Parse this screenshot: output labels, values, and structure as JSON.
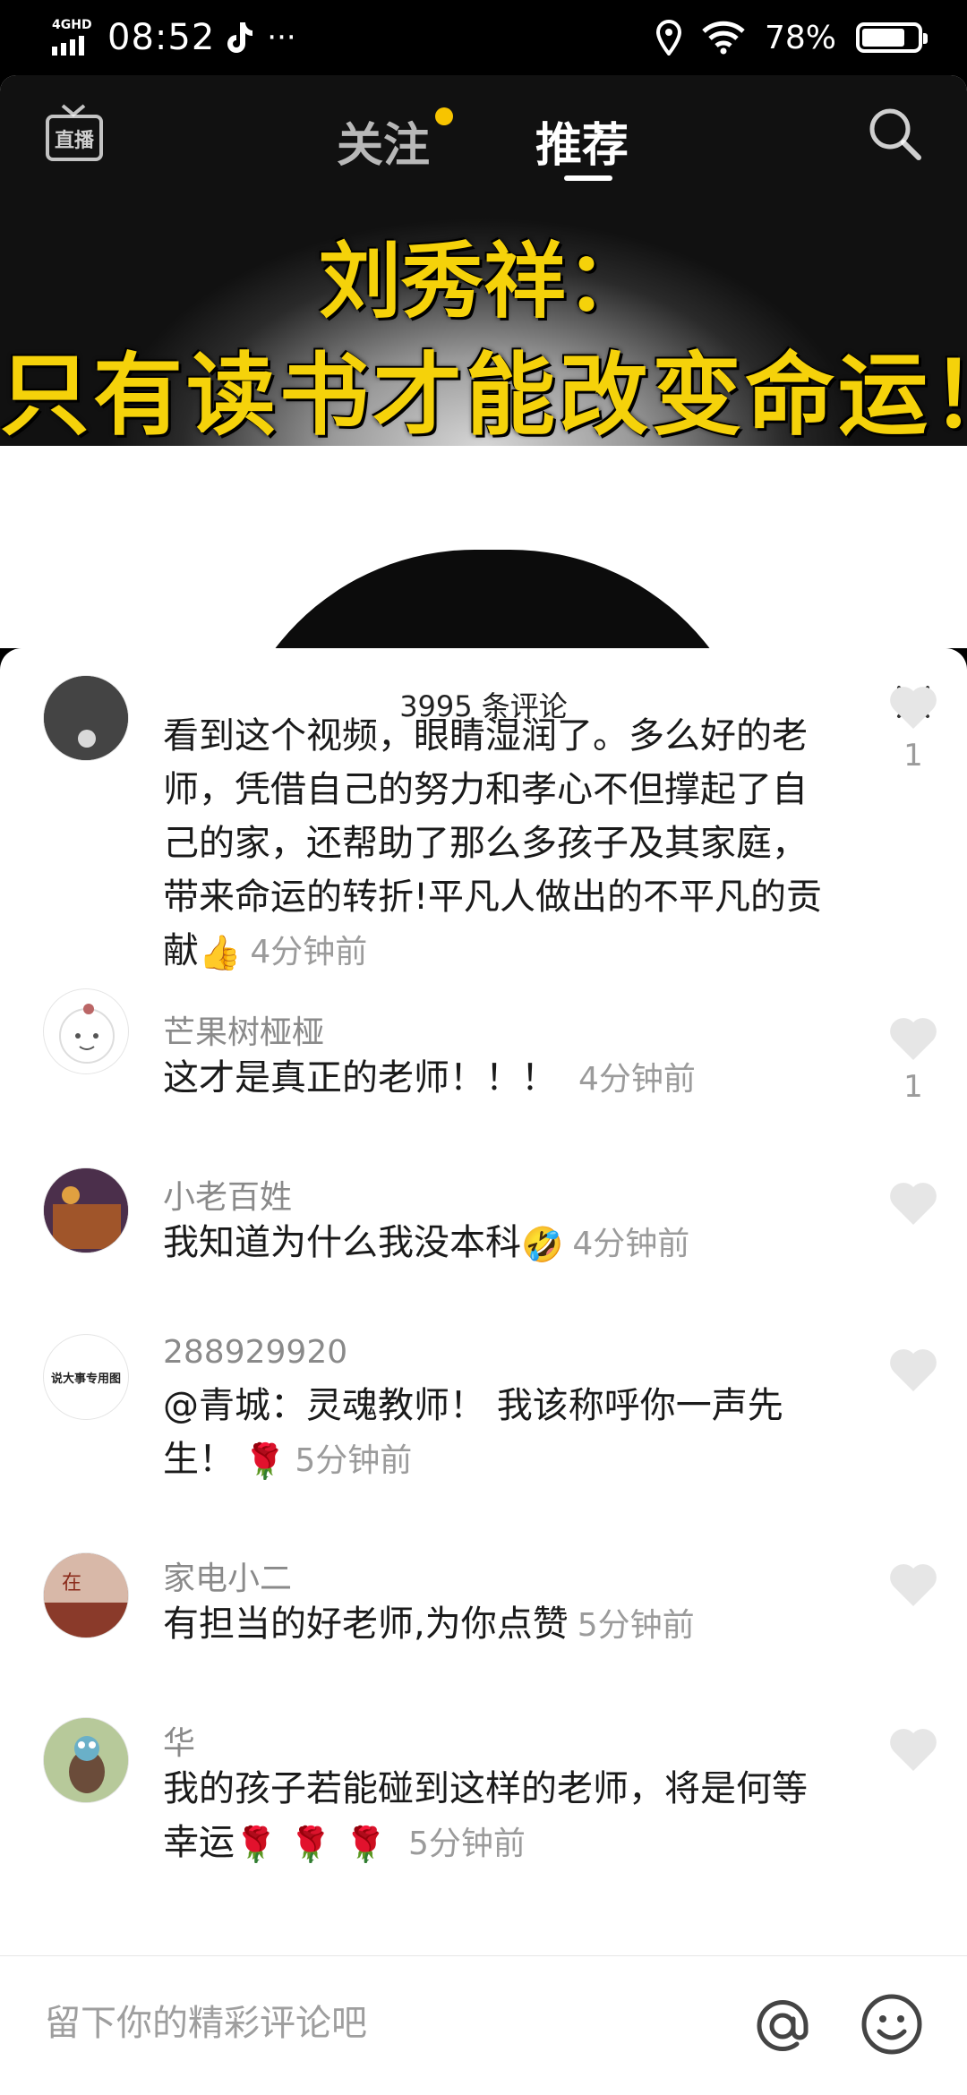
{
  "status_bar": {
    "network": "4GHD",
    "time": "08:52",
    "more": "···",
    "battery_percent": "78%",
    "battery_level": 0.78
  },
  "top_nav": {
    "live_icon": "live-tv-icon",
    "tabs": [
      {
        "label": "关注",
        "active": false,
        "has_dot": true
      },
      {
        "label": "推荐",
        "active": true
      }
    ],
    "search_icon": "search-icon"
  },
  "video": {
    "caption_line1": "刘秀祥：",
    "caption_line2": "只有读书才能改变命运！"
  },
  "comments_sheet": {
    "title": "3995 条评论",
    "comments": [
      {
        "user": "",
        "text": "看到这个视频，眼睛湿润了。多么好的老师，凭借自己的努力和孝心不但撑起了自己的家，还帮助了那么多孩子及其家庭，带来命运的转折!平凡人做出的不平凡的贡献",
        "emoji": "👍",
        "time": "4分钟前",
        "likes": "1"
      },
      {
        "user": "芒果树桠桠",
        "text": "这才是真正的老师！！！",
        "emoji": "",
        "time": "4分钟前",
        "likes": "1"
      },
      {
        "user": "小老百姓",
        "text": "我知道为什么我没本科",
        "emoji": "🤣",
        "time": "4分钟前",
        "likes": ""
      },
      {
        "user": "288929920",
        "avatar_text": "说大事专用图",
        "text": "@青城：灵魂教师！ 我该称呼你一声先生！",
        "emoji": "🌹",
        "time": "5分钟前",
        "likes": ""
      },
      {
        "user": "家电小二",
        "text": "有担当的好老师,为你点赞",
        "emoji": "",
        "time": "5分钟前",
        "likes": ""
      },
      {
        "user": "华",
        "text": "我的孩子若能碰到这样的老师，将是何等幸运",
        "emoji": "🌹🌹🌹",
        "time": "5分钟前",
        "likes": ""
      }
    ]
  },
  "input_bar": {
    "placeholder": "留下你的精彩评论吧",
    "at_icon": "at-sign-icon",
    "emoji_icon": "smiley-icon"
  }
}
